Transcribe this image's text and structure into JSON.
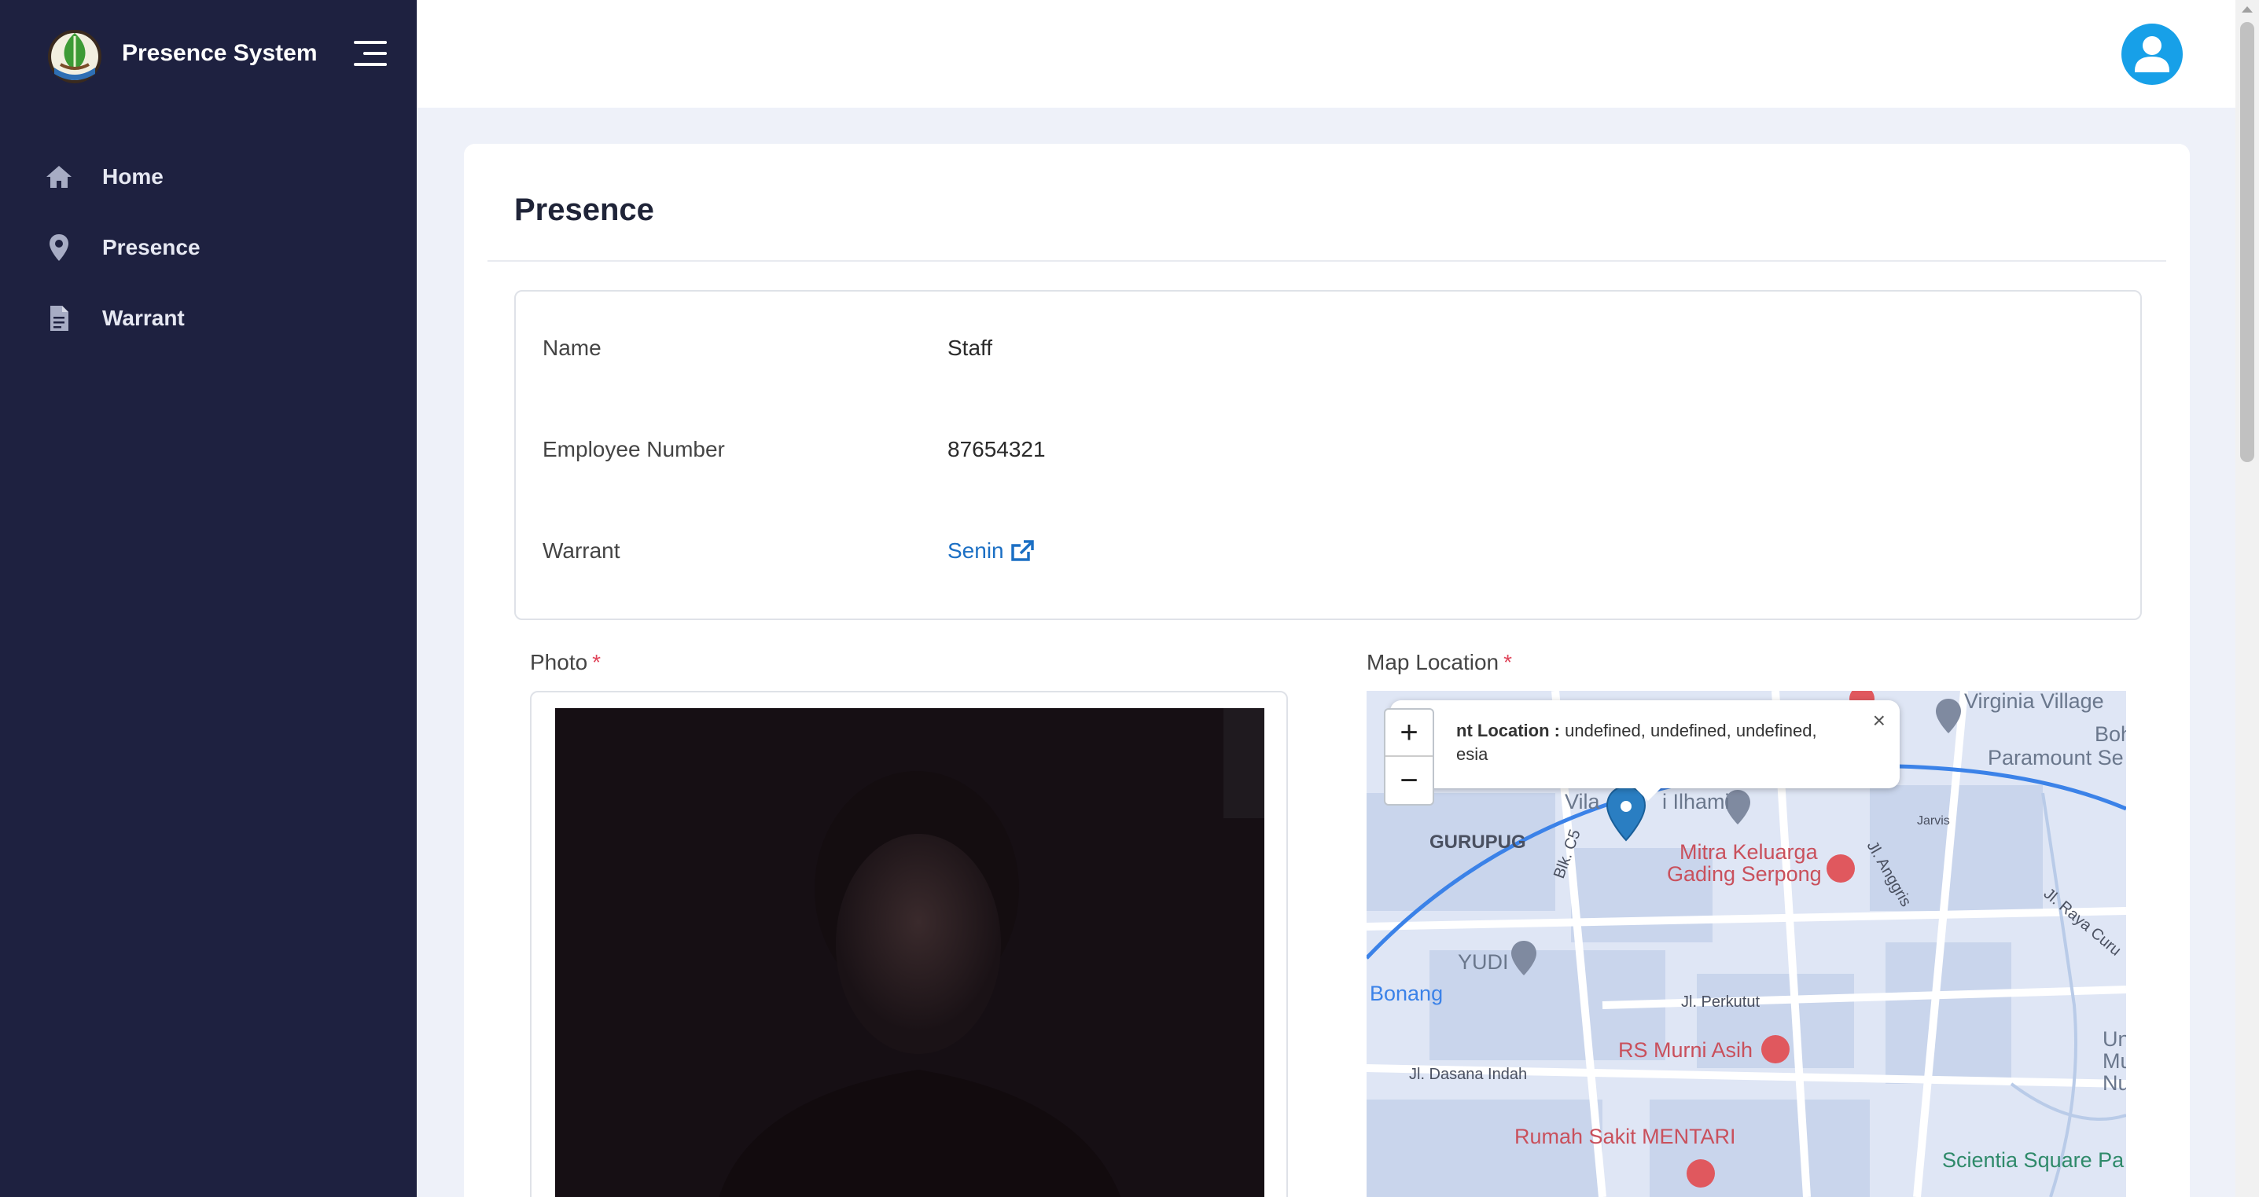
{
  "app": {
    "name": "Presence System"
  },
  "sidebar": {
    "items": [
      {
        "label": "Home",
        "icon": "home-icon"
      },
      {
        "label": "Presence",
        "icon": "map-pin-icon"
      },
      {
        "label": "Warrant",
        "icon": "document-icon"
      }
    ]
  },
  "page": {
    "title": "Presence"
  },
  "info": {
    "name_label": "Name",
    "name_value": "Staff",
    "employee_label": "Employee Number",
    "employee_value": "87654321",
    "warrant_label": "Warrant",
    "warrant_value": "Senin"
  },
  "form": {
    "photo_label": "Photo",
    "map_label": "Map Location",
    "required_mark": "*"
  },
  "map": {
    "zoom_in": "+",
    "zoom_out": "−",
    "popup_title": "nt Location :",
    "popup_text_line1": "undefined, undefined, undefined,",
    "popup_text_line2": "esia",
    "popup_close": "×",
    "places": {
      "virginia": "Virginia Village",
      "paramount": "Paramount Se",
      "villa": "Vila",
      "ilhami": "i Ilhami",
      "gurugug": "GURUPUG",
      "blk": "Blk. C5",
      "mitra1": "Mitra Keluarga",
      "mitra2": "Gading Serpong",
      "anggris": "Jl. Anggris",
      "jarvis": "Jarvis",
      "raya": "Jl. Raya Curu",
      "yudi": "YUDI",
      "bonang": "Bonang",
      "perkutut": "Jl. Perkutut",
      "murni": "RS Murni Asih",
      "dasana": "Jl. Dasana Indah",
      "mentari": "Rumah Sakit MENTARI",
      "scientia": "Scientia Square Pa",
      "boh": "Boh",
      "un": "Un",
      "mu": "Mu",
      "nu": "Nu"
    }
  },
  "colors": {
    "sidebar": "#1e2140",
    "accent": "#17a0e8",
    "link": "#1b6fc4",
    "required": "#e0455a"
  }
}
